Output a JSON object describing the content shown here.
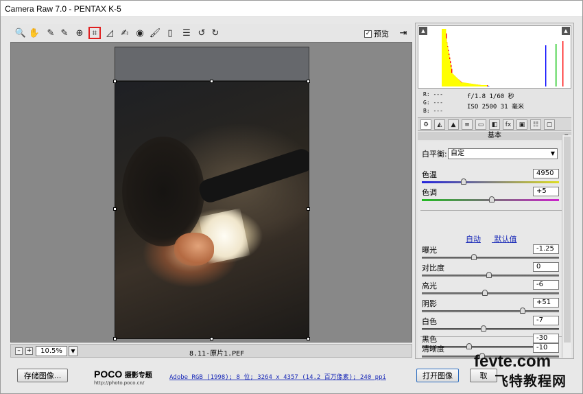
{
  "window": {
    "title": "Camera Raw 7.0 -  PENTAX K-5"
  },
  "toolbar": {
    "tools": [
      {
        "name": "zoom-tool",
        "glyph": "🔍"
      },
      {
        "name": "hand-tool",
        "glyph": "✋"
      },
      {
        "name": "white-balance-tool",
        "glyph": "✎"
      },
      {
        "name": "color-sampler-tool",
        "glyph": "✎"
      },
      {
        "name": "targeted-adjustment-tool",
        "glyph": "⊕"
      },
      {
        "name": "crop-tool",
        "glyph": "⌗",
        "active": true
      },
      {
        "name": "straighten-tool",
        "glyph": "◿"
      },
      {
        "name": "spot-removal-tool",
        "glyph": "✍"
      },
      {
        "name": "red-eye-tool",
        "glyph": "◉"
      },
      {
        "name": "adjustment-brush-tool",
        "glyph": "🖌"
      },
      {
        "name": "graduated-filter-tool",
        "glyph": "▯"
      },
      {
        "name": "preferences-tool",
        "glyph": "☰"
      },
      {
        "name": "rotate-left-tool",
        "glyph": "↺"
      },
      {
        "name": "rotate-right-tool",
        "glyph": "↻"
      }
    ],
    "preview_label": "预览",
    "preview_checked": "✓",
    "fullscreen_glyph": "⇥"
  },
  "status": {
    "zoom_minus": "–",
    "zoom_plus": "+",
    "zoom_value": "10.5%",
    "zoom_dropdown": "▼",
    "filename": "8.11-原片1.PEF"
  },
  "bottom": {
    "save_label": "存储图像...",
    "poco_brand": "POCO",
    "poco_title": "摄影专题",
    "poco_url": "http://photo.poco.cn/",
    "workflow": "Adobe RGB (1998); 8 位; 3264 x 4357 (14.2 百万像素); 240 ppi",
    "open_label": "打开图像",
    "cancel_label": "取",
    "watermark_top": "fevte.com",
    "watermark_bottom": "飞特教程网"
  },
  "histogram": {
    "clip_shadow": "▲",
    "clip_highlight": "▲",
    "peaks_note_colors": [
      "#ff0000",
      "#ffff00",
      "#00c000",
      "#0000ff",
      "#00ffff",
      "#ff00ff"
    ]
  },
  "info": {
    "r": "R:  ---",
    "g": "G:  ---",
    "b": "B:  ---",
    "aperture_shutter": "f/1.8   1/60 秒",
    "iso_focal": "ISO 2500   31 毫米"
  },
  "panel_tabs": [
    "⚙",
    "◭",
    "▲",
    "≡",
    "▭",
    "◧",
    "fx",
    "▣",
    "☷",
    "▢"
  ],
  "panel": {
    "title": "基本",
    "menu_glyph": "≡",
    "white_balance_label": "白平衡:",
    "white_balance_value": "自定",
    "white_balance_arrow": "▼",
    "auto_label": "自动",
    "default_label": "默认值",
    "sliders": [
      {
        "label": "色温",
        "value": "4950",
        "position": 0.31,
        "track": "temp"
      },
      {
        "label": "色调",
        "value": "+5",
        "position": 0.52,
        "track": "tint"
      },
      {
        "label": "曝光",
        "value": "-1.25",
        "position": 0.39,
        "track": "gray"
      },
      {
        "label": "对比度",
        "value": "0",
        "position": 0.5,
        "track": "gray"
      },
      {
        "label": "高光",
        "value": "-6",
        "position": 0.47,
        "track": "gray"
      },
      {
        "label": "阴影",
        "value": "+51",
        "position": 0.75,
        "track": "gray"
      },
      {
        "label": "白色",
        "value": "-7",
        "position": 0.46,
        "track": "gray"
      },
      {
        "label": "黑色",
        "value": "-30",
        "position": 0.35,
        "track": "gray"
      },
      {
        "label": "清晰度",
        "value": "-10",
        "position": 0.45,
        "track": "gray"
      }
    ]
  }
}
